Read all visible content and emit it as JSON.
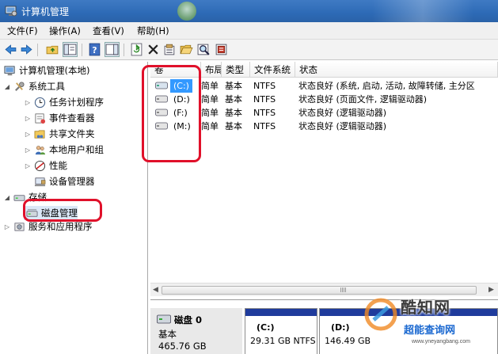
{
  "window": {
    "title": "计算机管理",
    "title_icon": "computer-management-icon"
  },
  "menu": {
    "items": [
      {
        "label": "文件(F)"
      },
      {
        "label": "操作(A)"
      },
      {
        "label": "查看(V)"
      },
      {
        "label": "帮助(H)"
      }
    ]
  },
  "toolbar": {
    "buttons": [
      "back-arrow-icon",
      "forward-arrow-icon",
      "up-folder-icon",
      "show-hide-tree-icon",
      "help-icon",
      "show-hide-action-icon",
      "refresh-icon",
      "delete-icon",
      "properties-icon",
      "open-folder-icon",
      "search-icon",
      "help-book-icon"
    ]
  },
  "tree": {
    "root": "计算机管理(本地)",
    "system_tools": "系统工具",
    "task_scheduler": "任务计划程序",
    "event_viewer": "事件查看器",
    "shared_folders": "共享文件夹",
    "local_users": "本地用户和组",
    "performance": "性能",
    "device_manager": "设备管理器",
    "storage": "存储",
    "disk_management": "磁盘管理",
    "services": "服务和应用程序"
  },
  "volumes": {
    "columns": [
      "卷",
      "布局",
      "类型",
      "文件系统",
      "状态"
    ],
    "rows": [
      {
        "vol": "(C:)",
        "layout": "简单",
        "type": "基本",
        "fs": "NTFS",
        "status": "状态良好 (系统, 启动, 活动, 故障转储, 主分区"
      },
      {
        "vol": "(D:)",
        "layout": "简单",
        "type": "基本",
        "fs": "NTFS",
        "status": "状态良好 (页面文件, 逻辑驱动器)"
      },
      {
        "vol": "(F:)",
        "layout": "简单",
        "type": "基本",
        "fs": "NTFS",
        "status": "状态良好 (逻辑驱动器)"
      },
      {
        "vol": "(M:)",
        "layout": "简单",
        "type": "基本",
        "fs": "NTFS",
        "status": "状态良好 (逻辑驱动器)"
      }
    ]
  },
  "disk": {
    "name": "磁盘 0",
    "kind": "基本",
    "size": "465.76 GB",
    "partitions": [
      {
        "label": "(C:)",
        "detail": "29.31 GB NTFS"
      },
      {
        "label": "(D:)",
        "detail": "146.49 GB"
      }
    ]
  },
  "watermark": {
    "line1": "酷知网",
    "line2": "超能查询网",
    "url": "www.yneyangbang.com"
  },
  "colors": {
    "title_bar": "#2d6ab6",
    "highlight_red": "#e0102a",
    "partition_band": "#1f3b9c",
    "selected_volume": "#3399ff"
  }
}
